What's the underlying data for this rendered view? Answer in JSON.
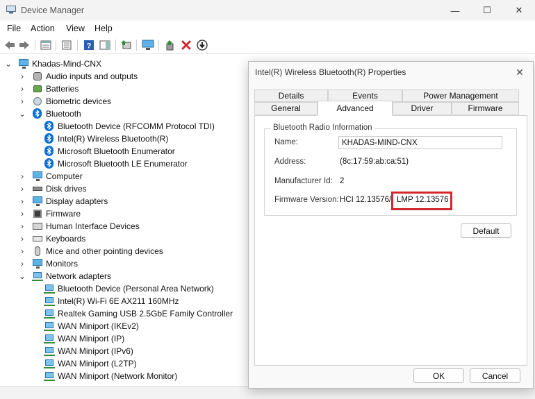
{
  "window": {
    "title": "Device Manager",
    "controls": {
      "minimize": "—",
      "maximize": "☐",
      "close": "✕"
    }
  },
  "menu": [
    "File",
    "Action",
    "View",
    "Help"
  ],
  "toolbar": {
    "icons": [
      "back-icon",
      "forward-icon",
      "properties-icon",
      "details-icon",
      "help-icon",
      "action-pane-icon",
      "update-driver-icon",
      "scan-hardware-icon",
      "enable-device-icon",
      "uninstall-icon",
      "disable-icon"
    ]
  },
  "tree": {
    "root": "Khadas-Mind-CNX",
    "categories": {
      "audio": "Audio inputs and outputs",
      "batteries": "Batteries",
      "biometric": "Biometric devices",
      "bluetooth": "Bluetooth",
      "computer": "Computer",
      "disk": "Disk drives",
      "display": "Display adapters",
      "firmware": "Firmware",
      "hid": "Human Interface Devices",
      "keyboards": "Keyboards",
      "mice": "Mice and other pointing devices",
      "monitors": "Monitors",
      "network": "Network adapters"
    },
    "bluetooth_devices": [
      "Bluetooth Device (RFCOMM Protocol TDI)",
      "Intel(R) Wireless Bluetooth(R)",
      "Microsoft Bluetooth Enumerator",
      "Microsoft Bluetooth LE Enumerator"
    ],
    "network_devices": [
      "Bluetooth Device (Personal Area Network)",
      "Intel(R) Wi-Fi 6E AX211 160MHz",
      "Realtek Gaming USB 2.5GbE Family Controller",
      "WAN Miniport (IKEv2)",
      "WAN Miniport (IP)",
      "WAN Miniport (IPv6)",
      "WAN Miniport (L2TP)",
      "WAN Miniport (Network Monitor)"
    ]
  },
  "dialog": {
    "title": "Intel(R) Wireless Bluetooth(R) Properties",
    "tabs_top": [
      "Details",
      "Events",
      "Power Management"
    ],
    "tabs_bottom": [
      "General",
      "Advanced",
      "Driver",
      "Firmware"
    ],
    "active_tab": "Advanced",
    "group_title": "Bluetooth Radio Information",
    "name_label": "Name:",
    "name_value": "KHADAS-MIND-CNX",
    "address_label": "Address:",
    "address_value": "(8c:17:59:ab:ca:51)",
    "manufacturer_label": "Manufacturer Id:",
    "manufacturer_value": "2",
    "firmware_label": "Firmware Version:",
    "firmware_hci": "HCI 12.13576",
    "firmware_sep": "/",
    "firmware_lmp": "LMP 12.13576",
    "highlight_color": "#d0282e",
    "default_button": "Default",
    "ok_button": "OK",
    "cancel_button": "Cancel"
  }
}
